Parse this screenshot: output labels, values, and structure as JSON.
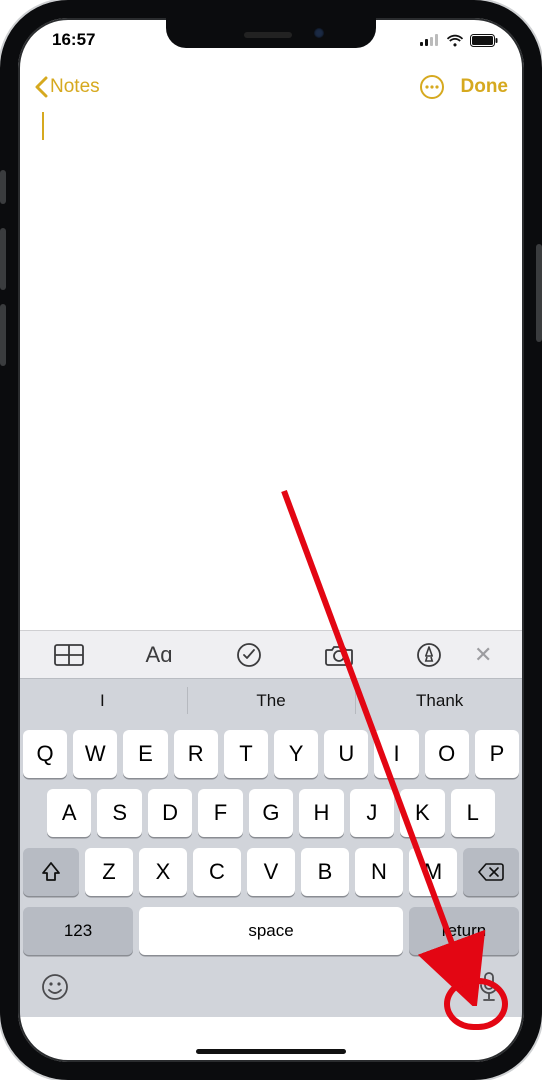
{
  "accent": "#d6a91f",
  "status": {
    "time": "16:57"
  },
  "nav": {
    "back_label": "Notes",
    "done_label": "Done"
  },
  "editor": {
    "content": ""
  },
  "notes_toolbar": {
    "items": [
      {
        "name": "table-icon"
      },
      {
        "name": "text-format-icon",
        "glyph": "Aɑ"
      },
      {
        "name": "checklist-icon"
      },
      {
        "name": "camera-icon"
      },
      {
        "name": "markup-icon"
      }
    ],
    "close_glyph": "✕"
  },
  "predictions": [
    "I",
    "The",
    "Thank"
  ],
  "keyboard": {
    "row1": [
      "Q",
      "W",
      "E",
      "R",
      "T",
      "Y",
      "U",
      "I",
      "O",
      "P"
    ],
    "row2": [
      "A",
      "S",
      "D",
      "F",
      "G",
      "H",
      "J",
      "K",
      "L"
    ],
    "row3": [
      "Z",
      "X",
      "C",
      "V",
      "B",
      "N",
      "M"
    ],
    "mode_label": "123",
    "space_label": "space",
    "return_label": "return"
  }
}
